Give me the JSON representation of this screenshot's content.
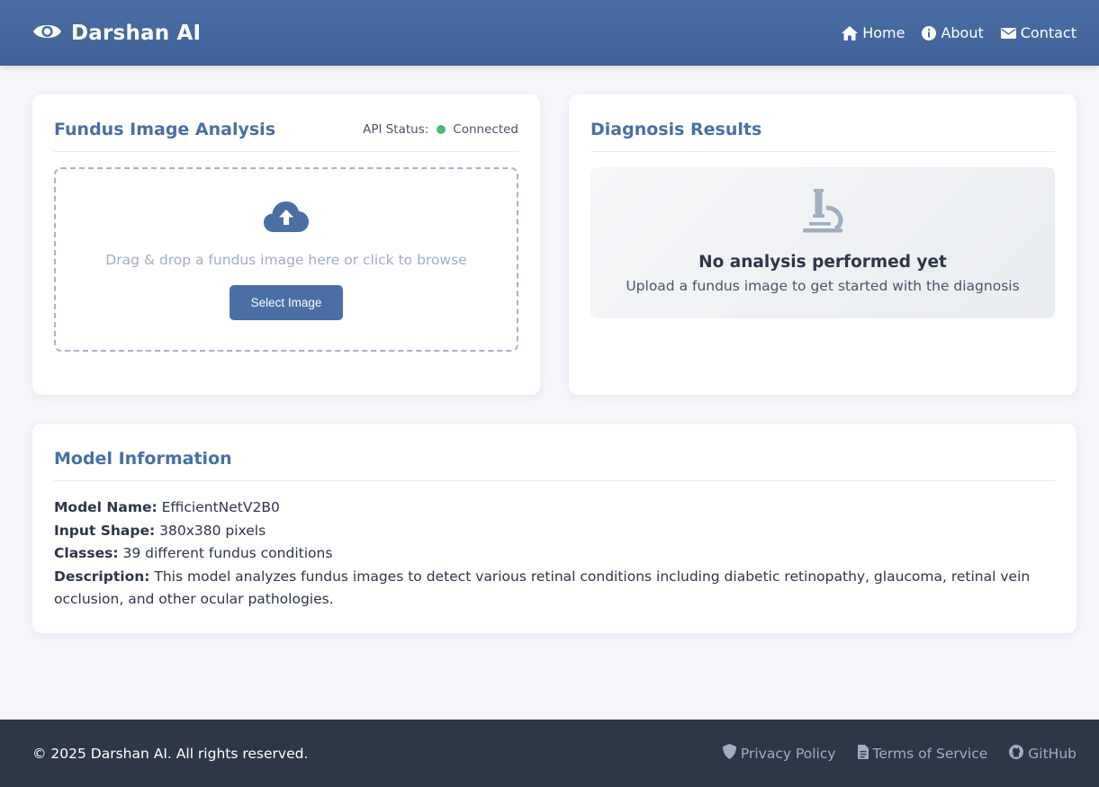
{
  "header": {
    "app_title": "Darshan AI",
    "logo_icon": "eye-icon",
    "nav": [
      {
        "label": "Home",
        "icon": "home-icon"
      },
      {
        "label": "About",
        "icon": "info-circle-icon"
      },
      {
        "label": "Contact",
        "icon": "envelope-icon"
      }
    ]
  },
  "upload_card": {
    "title": "Fundus Image Analysis",
    "api_status_label": "API Status:",
    "api_status_value": "Connected",
    "api_status_color": "#48bb78",
    "drop_text": "Drag & drop a fundus image here or click to browse",
    "select_button": "Select Image",
    "upload_icon": "cloud-upload-icon"
  },
  "results_card": {
    "title": "Diagnosis Results",
    "empty_icon": "microscope-icon",
    "empty_title": "No analysis performed yet",
    "empty_subtitle": "Upload a fundus image to get started with the diagnosis"
  },
  "model_card": {
    "title": "Model Information",
    "rows": [
      {
        "label": "Model Name:",
        "value": "EfficientNetV2B0"
      },
      {
        "label": "Input Shape:",
        "value": "380x380 pixels"
      },
      {
        "label": "Classes:",
        "value": "39 different fundus conditions"
      },
      {
        "label": "Description:",
        "value": "This model analyzes fundus images to detect various retinal conditions including diabetic retinopathy, glaucoma, retinal vein occlusion, and other ocular pathologies."
      }
    ]
  },
  "footer": {
    "copyright": "© 2025 Darshan AI. All rights reserved.",
    "links": [
      {
        "label": "Privacy Policy",
        "icon": "shield-icon"
      },
      {
        "label": "Terms of Service",
        "icon": "document-icon"
      },
      {
        "label": "GitHub",
        "icon": "github-icon"
      }
    ]
  },
  "colors": {
    "primary": "#4a6fa5",
    "footer_bg": "#2d3748",
    "page_bg": "#f4f6fa"
  }
}
